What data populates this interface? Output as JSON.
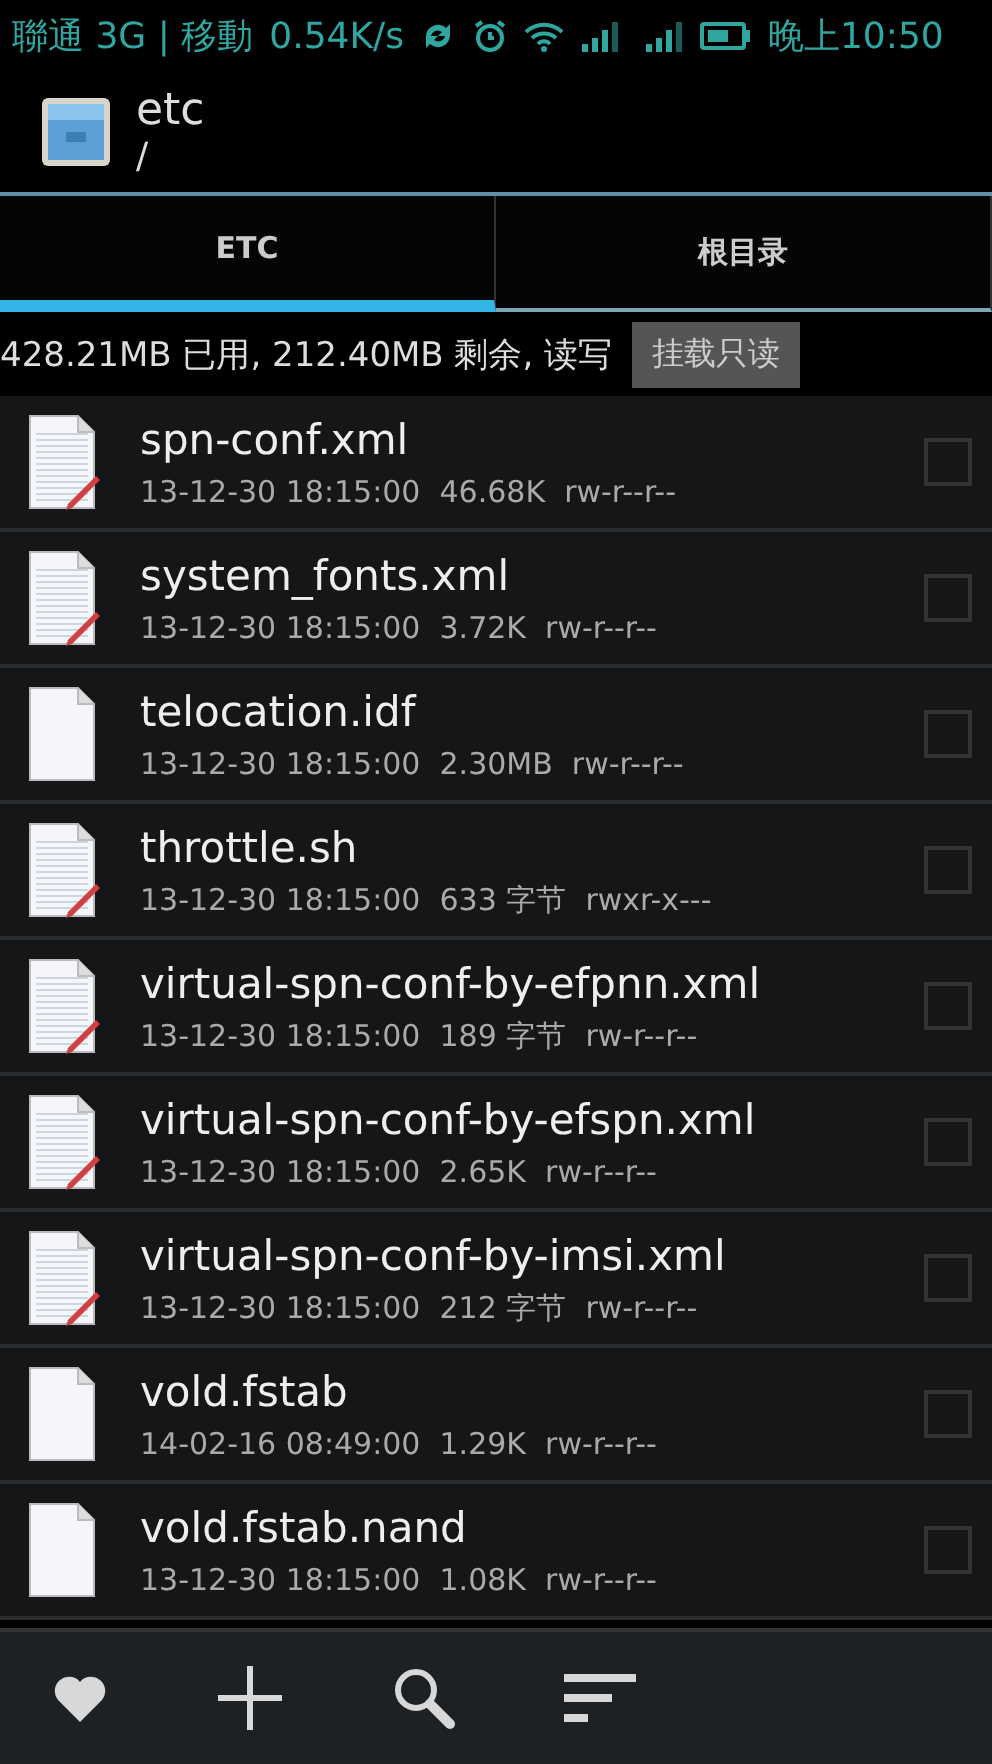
{
  "status_bar": {
    "carrier": "聯通 3G | 移動",
    "speed": "0.54K/s",
    "time": "晚上10:50"
  },
  "header": {
    "title": "etc",
    "path": "/"
  },
  "tabs": [
    {
      "label": "ETC",
      "selected": true
    },
    {
      "label": "根目录",
      "selected": false
    }
  ],
  "storage": {
    "info": "428.21MB 已用, 212.40MB 剩余, 读写",
    "button": "挂载只读"
  },
  "files": [
    {
      "name": "spn-conf.xml",
      "kind": "text",
      "date": "13-12-30 18:15:00",
      "size": "46.68K",
      "perms": "rw-r--r--",
      "checked": false
    },
    {
      "name": "system_fonts.xml",
      "kind": "text",
      "date": "13-12-30 18:15:00",
      "size": "3.72K",
      "perms": "rw-r--r--",
      "checked": false
    },
    {
      "name": "telocation.idf",
      "kind": "blank",
      "date": "13-12-30 18:15:00",
      "size": "2.30MB",
      "perms": "rw-r--r--",
      "checked": false
    },
    {
      "name": "throttle.sh",
      "kind": "text",
      "date": "13-12-30 18:15:00",
      "size": "633 字节",
      "perms": "rwxr-x---",
      "checked": false
    },
    {
      "name": "virtual-spn-conf-by-efpnn.xml",
      "kind": "text",
      "date": "13-12-30 18:15:00",
      "size": "189 字节",
      "perms": "rw-r--r--",
      "checked": false
    },
    {
      "name": "virtual-spn-conf-by-efspn.xml",
      "kind": "text",
      "date": "13-12-30 18:15:00",
      "size": "2.65K",
      "perms": "rw-r--r--",
      "checked": false
    },
    {
      "name": "virtual-spn-conf-by-imsi.xml",
      "kind": "text",
      "date": "13-12-30 18:15:00",
      "size": "212 字节",
      "perms": "rw-r--r--",
      "checked": false
    },
    {
      "name": "vold.fstab",
      "kind": "blank",
      "date": "14-02-16 08:49:00",
      "size": "1.29K",
      "perms": "rw-r--r--",
      "checked": false
    },
    {
      "name": "vold.fstab.nand",
      "kind": "blank",
      "date": "13-12-30 18:15:00",
      "size": "1.08K",
      "perms": "rw-r--r--",
      "checked": false
    }
  ],
  "toolbar": [
    {
      "kind": "favorite"
    },
    {
      "kind": "add"
    },
    {
      "kind": "search"
    },
    {
      "kind": "sort"
    }
  ]
}
